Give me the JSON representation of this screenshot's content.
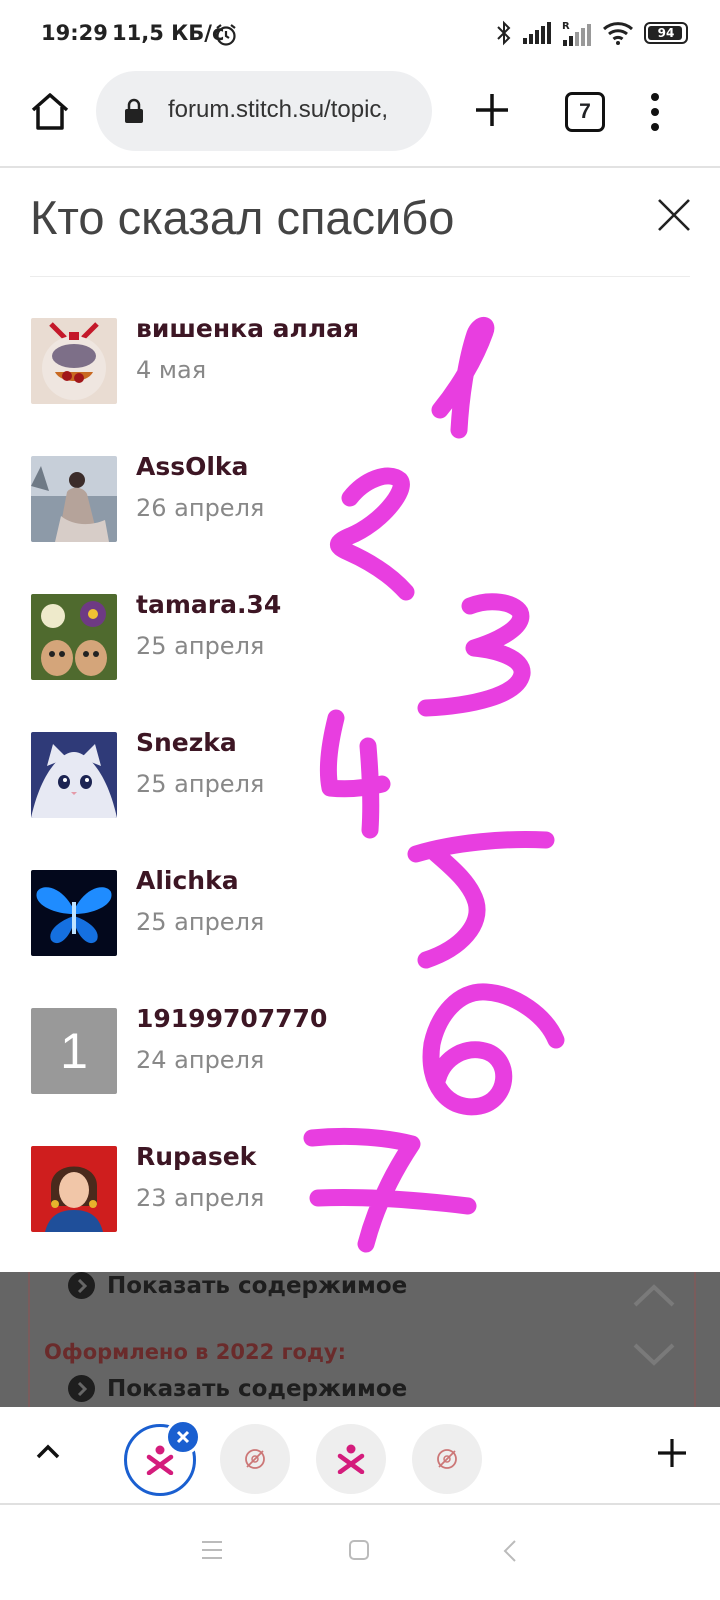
{
  "status_bar": {
    "time": "19:29",
    "speed": "11,5 КБ/с",
    "battery": "94",
    "battery_level": 0.94,
    "icons": [
      "alarm-icon",
      "bluetooth-icon",
      "signal-icon",
      "signal-roaming-icon",
      "wifi-icon",
      "battery-icon"
    ]
  },
  "browser": {
    "url": "forum.stitch.su/topic,",
    "tab_count": "7",
    "icons": [
      "home-icon",
      "lock-icon",
      "plus-icon",
      "tabs-icon",
      "more-icon"
    ]
  },
  "dialog": {
    "title": "Кто сказал спасибо",
    "users": [
      {
        "name": "вишенка аллая",
        "date": "4 мая",
        "avatar": "decoupage-ball"
      },
      {
        "name": "AssOlka",
        "date": "26 апреля",
        "avatar": "woman-seaside"
      },
      {
        "name": "tamara.34",
        "date": "25 апреля",
        "avatar": "flower-dolls"
      },
      {
        "name": "Snezka",
        "date": "25 апреля",
        "avatar": "white-kitten"
      },
      {
        "name": "Alichka",
        "date": "25 апреля",
        "avatar": "blue-butterfly"
      },
      {
        "name": "19199707770",
        "date": "24 апреля",
        "avatar": "initial",
        "initial": "1"
      },
      {
        "name": "Rupasek",
        "date": "23 апреля",
        "avatar": "portrait-woman"
      }
    ]
  },
  "handwritten_numbers": [
    "1",
    "2",
    "3",
    "4",
    "5",
    "6",
    "7"
  ],
  "background_page": {
    "spoiler_1": "Показать содержимое",
    "heading": "Оформлено в 2022 году:",
    "spoiler_2": "Показать содержимое"
  },
  "tab_strip": {
    "tabs": [
      "active-tab",
      "tab",
      "tab",
      "tab"
    ]
  },
  "colors": {
    "accent": "#1a5fd0",
    "handwriting": "#e83ee0",
    "username": "#3d1624",
    "date": "#888888",
    "overlay": "#656565"
  }
}
